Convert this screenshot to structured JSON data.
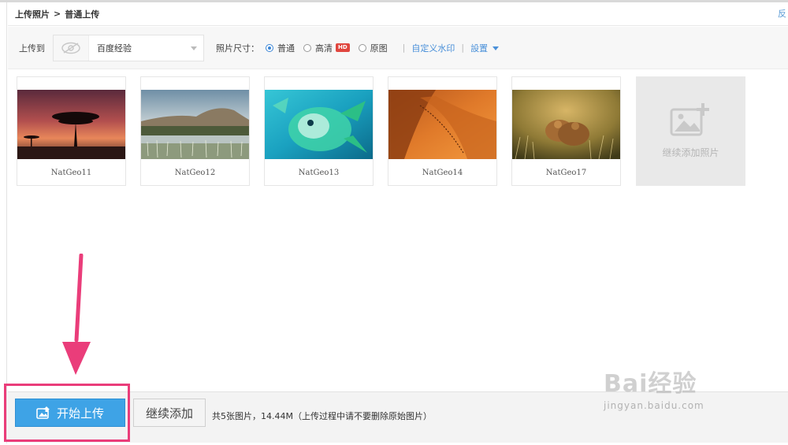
{
  "breadcrumb": {
    "root": "上传照片",
    "sep": ">",
    "current": "普通上传"
  },
  "corner_link": "反",
  "toolbar": {
    "upload_to_label": "上传到",
    "album": "百度经验",
    "size_label": "照片尺寸：",
    "options": [
      {
        "label": "普通",
        "selected": true
      },
      {
        "label": "高清",
        "selected": false,
        "badge": "HD"
      },
      {
        "label": "原图",
        "selected": false
      }
    ],
    "watermark_link": "自定义水印",
    "settings_link": "設置"
  },
  "photos": [
    {
      "name": "NatGeo11",
      "scene": "acacia-sunset"
    },
    {
      "name": "NatGeo12",
      "scene": "mountain-lake"
    },
    {
      "name": "NatGeo13",
      "scene": "blue-fish"
    },
    {
      "name": "NatGeo14",
      "scene": "orange-dunes"
    },
    {
      "name": "NatGeo17",
      "scene": "lion-cubs"
    }
  ],
  "add_tile": {
    "label": "继续添加照片",
    "icon": "add-photo-icon"
  },
  "footer": {
    "start_label": "开始上传",
    "more_label": "继续添加",
    "summary": "共5张图片，14.44M（上传过程中请不要删除原始图片）"
  },
  "watermark": {
    "brand": "Bai经验",
    "url": "jingyan.baidu.com"
  },
  "colors": {
    "accent": "#3ea3e6",
    "highlight": "#ea3d7a",
    "link": "#4a90d9",
    "hd_badge": "#e0463e"
  }
}
